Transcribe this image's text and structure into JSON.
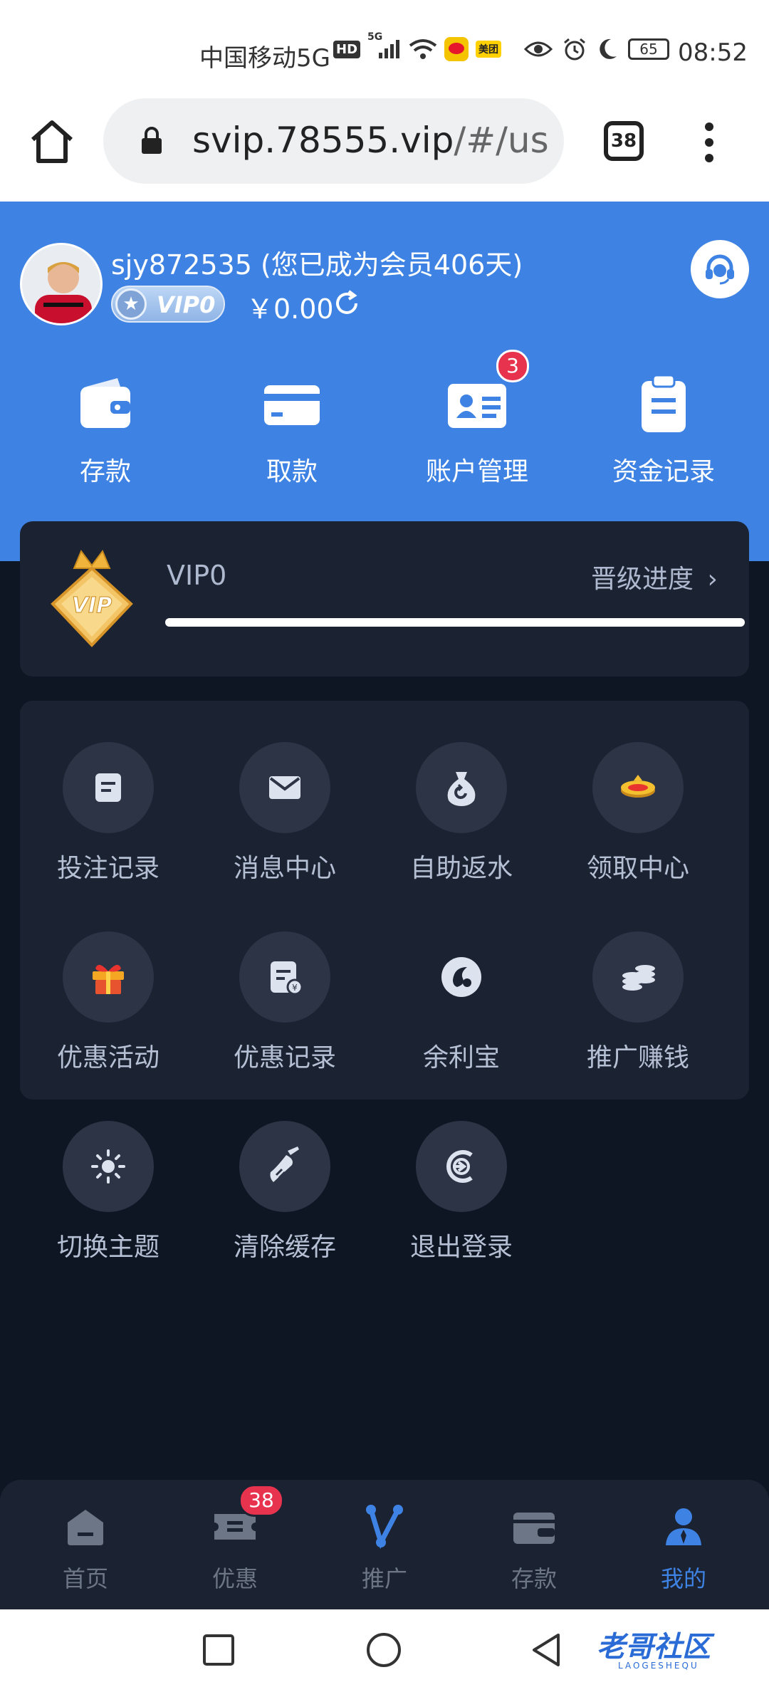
{
  "status_bar": {
    "carrier": "中国移动5G",
    "hd": "HD",
    "net": "5G",
    "meituan": "美团",
    "battery": "65",
    "time": "08:52"
  },
  "browser": {
    "url_host": "svip.78555.vip",
    "url_path": "/#/us",
    "tab_count": "38"
  },
  "header": {
    "username": "sjy872535 (您已成为会员406天)",
    "vip_badge": "VIP0",
    "balance": "￥0.00",
    "quick_actions": [
      {
        "label": "存款",
        "icon": "wallet-icon"
      },
      {
        "label": "取款",
        "icon": "card-icon"
      },
      {
        "label": "账户管理",
        "icon": "id-card-icon",
        "badge": "3"
      },
      {
        "label": "资金记录",
        "icon": "clipboard-icon"
      }
    ]
  },
  "vip": {
    "emblem_text": "VIP",
    "level": "VIP0",
    "progress_link": "晋级进度",
    "progress": 1.0
  },
  "menu": {
    "items": [
      {
        "label": "投注记录",
        "icon": "document-icon"
      },
      {
        "label": "消息中心",
        "icon": "mail-icon"
      },
      {
        "label": "自助返水",
        "icon": "money-bag-icon"
      },
      {
        "label": "领取中心",
        "icon": "gold-coin-icon"
      },
      {
        "label": "优惠活动",
        "icon": "gift-icon"
      },
      {
        "label": "优惠记录",
        "icon": "receipt-icon"
      },
      {
        "label": "余利宝",
        "icon": "yulibao-icon"
      },
      {
        "label": "推广赚钱",
        "icon": "coins-stack-icon"
      },
      {
        "label": "切换主题",
        "icon": "sun-icon"
      },
      {
        "label": "清除缓存",
        "icon": "broom-icon"
      },
      {
        "label": "退出登录",
        "icon": "logout-icon"
      }
    ]
  },
  "bottom_nav": {
    "items": [
      {
        "label": "首页",
        "icon": "home-icon"
      },
      {
        "label": "优惠",
        "icon": "ticket-icon",
        "badge": "38"
      },
      {
        "label": "推广",
        "icon": "share-icon"
      },
      {
        "label": "存款",
        "icon": "wallet-icon"
      },
      {
        "label": "我的",
        "icon": "user-icon",
        "active": true
      }
    ]
  },
  "watermark": {
    "text": "老哥社区",
    "sub": "LAOGESHEQU"
  },
  "colors": {
    "accent": "#3e83e4",
    "background": "#0f1623",
    "card": "#1b2232",
    "badge": "#e8334f"
  }
}
